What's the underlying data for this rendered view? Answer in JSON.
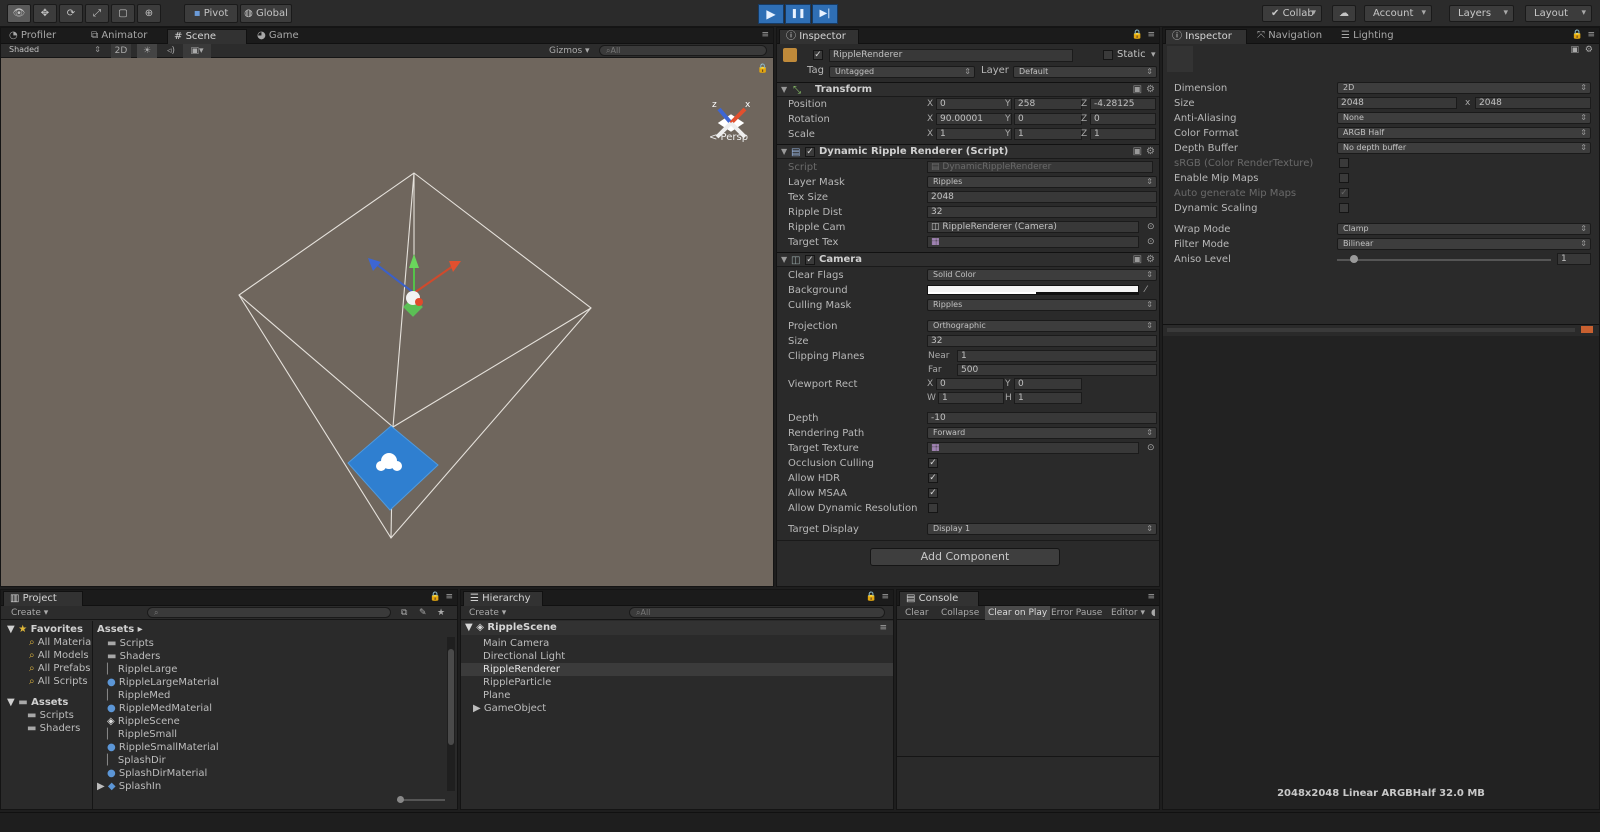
{
  "toolbar": {
    "tools": [
      "eye-icon",
      "move-icon",
      "rotate-icon",
      "scale-icon",
      "rect-icon",
      "transform-icon"
    ],
    "pivot": "Pivot",
    "global": "Global",
    "play": "▶",
    "pause": "❚❚",
    "step": "▶|",
    "collab": "Collab",
    "cloud": "☁",
    "account": "Account",
    "layers": "Layers",
    "layout": "Layout"
  },
  "scene": {
    "tabs": [
      "Profiler",
      "Animator",
      "Scene",
      "Game"
    ],
    "shaded": "Shaded",
    "mode2d": "2D",
    "gizmos": "Gizmos",
    "search_placeholder": "All",
    "persp": "< Persp"
  },
  "inspector": {
    "tab": "Inspector",
    "object": {
      "name": "RippleRenderer",
      "static": "Static",
      "tag_label": "Tag",
      "tag": "Untagged",
      "layer_label": "Layer",
      "layer": "Default"
    },
    "transform": {
      "title": "Transform",
      "position": {
        "label": "Position",
        "x": "0",
        "y": "258",
        "z": "-4.28125"
      },
      "rotation": {
        "label": "Rotation",
        "x": "90.00001",
        "y": "0",
        "z": "0"
      },
      "scale": {
        "label": "Scale",
        "x": "1",
        "y": "1",
        "z": "1"
      }
    },
    "script": {
      "title": "Dynamic Ripple Renderer (Script)",
      "script_label": "Script",
      "script_value": "DynamicRippleRenderer",
      "layer_mask_label": "Layer Mask",
      "layer_mask": "Ripples",
      "tex_size_label": "Tex Size",
      "tex_size": "2048",
      "ripple_dist_label": "Ripple Dist",
      "ripple_dist": "32",
      "ripple_cam_label": "Ripple Cam",
      "ripple_cam": "RippleRenderer (Camera)",
      "target_tex_label": "Target Tex"
    },
    "camera": {
      "title": "Camera",
      "clear_flags_label": "Clear Flags",
      "clear_flags": "Solid Color",
      "background_label": "Background",
      "culling_mask_label": "Culling Mask",
      "culling_mask": "Ripples",
      "projection_label": "Projection",
      "projection": "Orthographic",
      "size_label": "Size",
      "size": "32",
      "clipping_label": "Clipping Planes",
      "near_label": "Near",
      "near": "1",
      "far_label": "Far",
      "far": "500",
      "viewport_label": "Viewport Rect",
      "vx": "0",
      "vy": "0",
      "vw": "1",
      "vh": "1",
      "depth_label": "Depth",
      "depth": "-10",
      "rendering_path_label": "Rendering Path",
      "rendering_path": "Forward",
      "target_texture_label": "Target Texture",
      "occlusion_label": "Occlusion Culling",
      "hdr_label": "Allow HDR",
      "msaa_label": "Allow MSAA",
      "dyn_res_label": "Allow Dynamic Resolution",
      "target_display_label": "Target Display",
      "target_display": "Display 1"
    },
    "add_component": "Add Component"
  },
  "inspector2": {
    "tabs": [
      "Inspector",
      "Navigation",
      "Lighting"
    ],
    "dimension_label": "Dimension",
    "dimension": "2D",
    "size_label": "Size",
    "size_w": "2048",
    "size_x": "x",
    "size_h": "2048",
    "aa_label": "Anti-Aliasing",
    "aa": "None",
    "color_format_label": "Color Format",
    "color_format": "ARGB Half",
    "depth_buffer_label": "Depth Buffer",
    "depth_buffer": "No depth buffer",
    "srgb_label": "sRGB (Color RenderTexture)",
    "mip_label": "Enable Mip Maps",
    "auto_mip_label": "Auto generate Mip Maps",
    "dyn_scale_label": "Dynamic Scaling",
    "wrap_label": "Wrap Mode",
    "wrap": "Clamp",
    "filter_label": "Filter Mode",
    "filter": "Bilinear",
    "aniso_label": "Aniso Level",
    "aniso": "1",
    "preview_info": "2048x2048 Linear  ARGBHalf  32.0 MB"
  },
  "project": {
    "tab": "Project",
    "create": "Create",
    "favorites_label": "Favorites",
    "favorites": [
      "All Materia",
      "All Models",
      "All Prefabs",
      "All Scripts"
    ],
    "assets_label": "Assets",
    "asset_folders": [
      "Scripts",
      "Shaders"
    ],
    "breadcrumb": "Assets ▸",
    "files": [
      {
        "name": "Scripts",
        "icon": "folder"
      },
      {
        "name": "Shaders",
        "icon": "folder"
      },
      {
        "name": "RippleLarge",
        "icon": "file"
      },
      {
        "name": "RippleLargeMaterial",
        "icon": "sphere"
      },
      {
        "name": "RippleMed",
        "icon": "file"
      },
      {
        "name": "RippleMedMaterial",
        "icon": "sphere"
      },
      {
        "name": "RippleScene",
        "icon": "unity"
      },
      {
        "name": "RippleSmall",
        "icon": "file"
      },
      {
        "name": "RippleSmallMaterial",
        "icon": "sphere"
      },
      {
        "name": "SplashDir",
        "icon": "file"
      },
      {
        "name": "SplashDirMaterial",
        "icon": "sphere"
      },
      {
        "name": "SplashIn",
        "icon": "prefab"
      }
    ]
  },
  "hierarchy": {
    "tab": "Hierarchy",
    "create": "Create",
    "search_placeholder": "All",
    "scene": "RippleScene",
    "items": [
      "Main Camera",
      "Directional Light",
      "RippleRenderer",
      "RippleParticle",
      "Plane",
      "GameObject"
    ]
  },
  "console": {
    "tab": "Console",
    "buttons": [
      "Clear",
      "Collapse",
      "Clear on Play",
      "Error Pause",
      "Editor"
    ]
  },
  "colors": {
    "accent": "#2f6fb5",
    "selection": "#3e5f8a",
    "scene_bg": "#6f665d"
  }
}
